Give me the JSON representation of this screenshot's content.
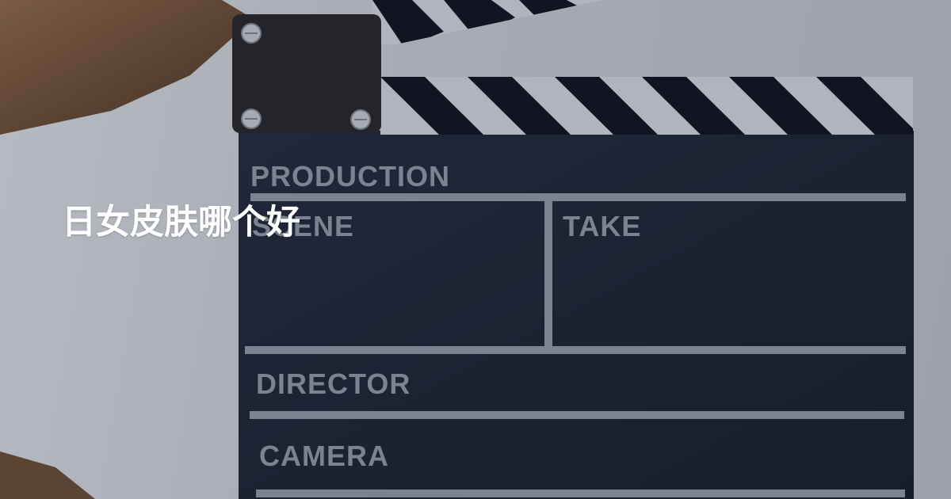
{
  "page": {
    "title": "日女皮肤哪个好"
  },
  "clapperboard": {
    "labels": {
      "production": "PRODUCTION",
      "scene": "SCENE",
      "take": "TAKE",
      "director": "DIRECTOR",
      "camera": "CAMERA"
    }
  },
  "colors": {
    "background": "#a7abb3",
    "board": "#1d2332",
    "label": "#7b8390",
    "title": "#ffffff"
  }
}
